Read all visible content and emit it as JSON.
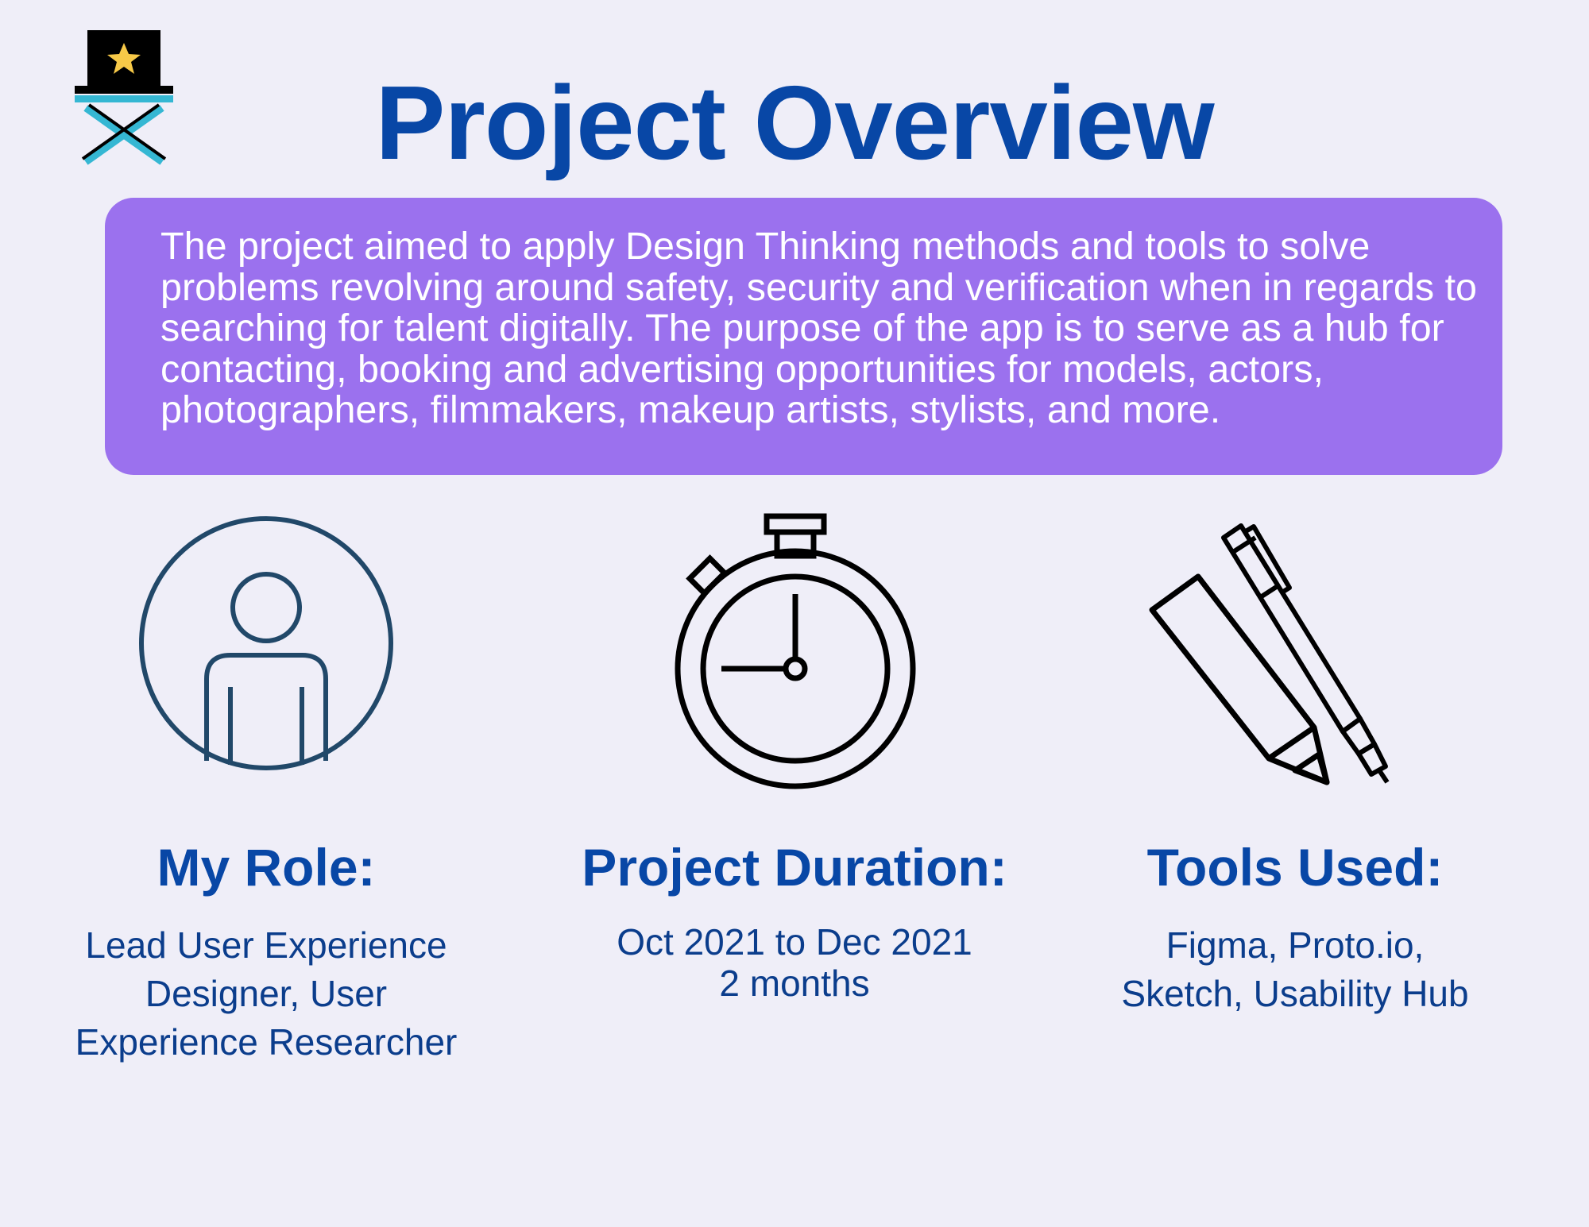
{
  "title": "Project Overview",
  "summary": "The project aimed to apply Design Thinking methods and tools to solve problems revolving around safety, security and verification when in regards to searching for talent digitally. The purpose of the app is to serve as a hub for contacting, booking and advertising opportunities for models, actors, photographers, filmmakers, makeup artists, stylists, and more.",
  "columns": {
    "role": {
      "icon": "person-icon",
      "heading": "My Role:",
      "lines": [
        "Lead User Experience",
        "Designer, User",
        "Experience Researcher"
      ]
    },
    "duration": {
      "icon": "stopwatch-icon",
      "heading": "Project Duration:",
      "lines": [
        "Oct 2021 to Dec 2021",
        "2 months"
      ]
    },
    "tools": {
      "icon": "pen-and-marker-icon",
      "heading": "Tools Used:",
      "lines": [
        "Figma, Proto.io,",
        "Sketch, Usability Hub"
      ]
    }
  },
  "colors": {
    "background": "#efeef8",
    "title": "#0847a6",
    "summary_box": "#9b71ee",
    "body_text": "#0b3d8c"
  }
}
